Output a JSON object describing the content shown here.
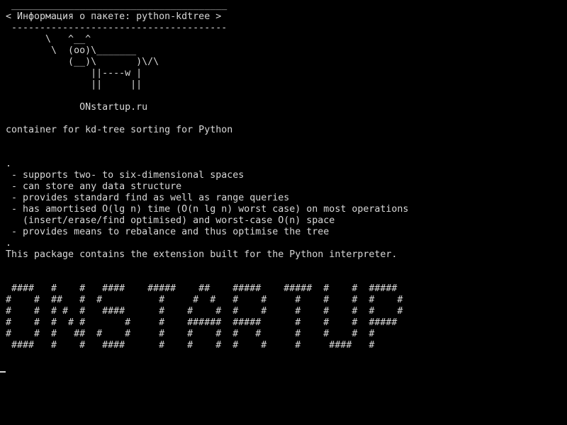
{
  "terminal": {
    "colors": {
      "background": "#000000",
      "foreground": "#d8d8d8"
    },
    "lines": [
      " ______________________________________",
      "< Информация о пакете: python-kdtree >",
      " --------------------------------------",
      "       \\   ^__^",
      "        \\  (oo)\\_______",
      "           (__)\\       )\\/\\",
      "               ||----w |",
      "               ||     ||",
      "",
      "             ONstartup.ru",
      "",
      "container for kd-tree sorting for Python",
      "",
      "",
      ".",
      " - supports two- to six-dimensional spaces",
      " - can store any data structure",
      " - provides standard find as well as range queries",
      " - has amortised O(lg n) time (O(n lg n) worst case) on most operations",
      "   (insert/erase/find optimised) and worst-case O(n) space",
      " - provides means to rebalance and thus optimise the tree",
      ".",
      "This package contains the extension built for the Python interpreter.",
      "",
      "",
      " ####   #    #   ####    #####    ##    #####    #####  #    #  #####",
      "#    #  ##   #  #          #     #  #   #    #     #    #    #  #    #",
      "#    #  # #  #   ####      #    #    #  #    #     #    #    #  #    #",
      "#    #  #  # #       #     #    ######  #####      #    #    #  #####",
      "#    #  #   ##  #    #     #    #    #  #   #      #    #    #  #",
      " ####   #    #   ####      #    #    #  #    #     #     ####   #"
    ]
  }
}
